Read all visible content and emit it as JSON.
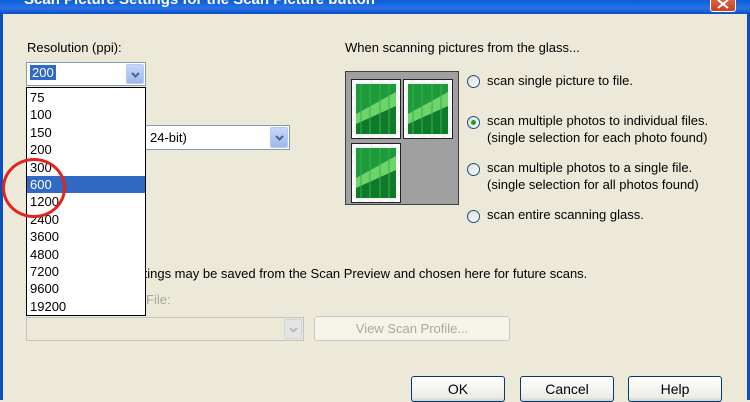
{
  "window": {
    "title": "Scan Picture Settings for the Scan Picture button"
  },
  "resolution": {
    "label": "Resolution (ppi):",
    "current_value": "200",
    "options": [
      "75",
      "100",
      "150",
      "200",
      "300",
      "600",
      "1200",
      "2400",
      "3600",
      "4800",
      "7200",
      "9600",
      "19200"
    ],
    "highlighted": "600"
  },
  "color_combo": {
    "visible_value": "24-bit)"
  },
  "glass": {
    "heading": "When scanning pictures from the glass...",
    "options": [
      {
        "label": "scan single picture to file.",
        "sub": "",
        "selected": false
      },
      {
        "label": "scan multiple photos to individual files.",
        "sub": "(single selection for each photo found)",
        "selected": true
      },
      {
        "label": "scan multiple photos to a single file.",
        "sub": "(single selection for all photos found)",
        "selected": false
      },
      {
        "label": "scan entire scanning glass.",
        "sub": "",
        "selected": false
      }
    ]
  },
  "profile": {
    "note": "ttings may be saved from the Scan Preview and chosen here for future scans.",
    "field_label": "File:",
    "view_button": "View Scan Profile..."
  },
  "buttons": {
    "ok": "OK",
    "cancel": "Cancel",
    "help": "Help"
  },
  "colors": {
    "selection": "#316ac5",
    "annotation": "#e1251b",
    "titlebar": "#0a5fd8"
  }
}
